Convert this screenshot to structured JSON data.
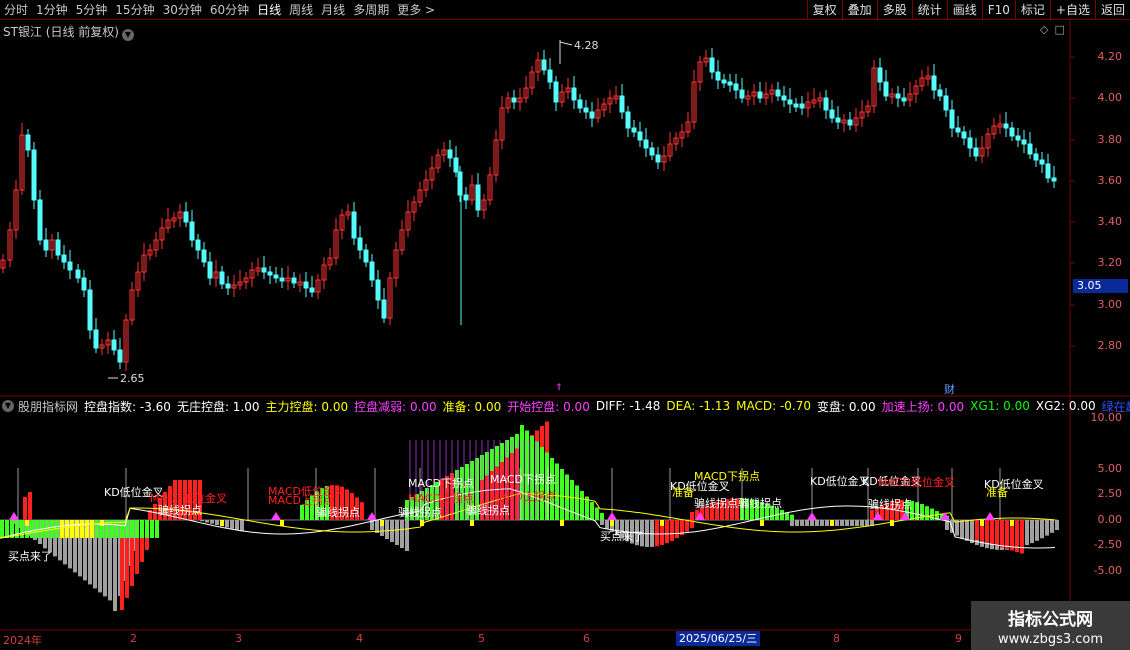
{
  "top_bar": {
    "periods": [
      "分时",
      "1分钟",
      "5分钟",
      "15分钟",
      "30分钟",
      "60分钟",
      "日线",
      "周线",
      "月线",
      "多周期",
      "更多 >"
    ],
    "active_period": "日线",
    "buttons": [
      "复权",
      "叠加",
      "多股",
      "统计",
      "画线",
      "F10",
      "标记",
      "+自选",
      "返回"
    ]
  },
  "stock": {
    "title": "ST银江 (日线 前复权)",
    "y_ticks": [
      "4.20",
      "4.00",
      "3.80",
      "3.60",
      "3.40",
      "3.20",
      "3.00",
      "2.80"
    ],
    "current_price": "3.05",
    "max_label": "4.28",
    "min_label": "2.65",
    "finance_marker": "财",
    "up_color": "#ff3232",
    "down_color": "#54fcfc"
  },
  "indicator": {
    "header": [
      {
        "text": "股朋指标网",
        "color": "#c8c8c8"
      },
      {
        "text": "控盘指数: -3.60",
        "color": "#ffffff"
      },
      {
        "text": "无庄控盘: 1.00",
        "color": "#ffffff"
      },
      {
        "text": "主力控盘: 0.00",
        "color": "#ffff00"
      },
      {
        "text": "控盘减弱: 0.00",
        "color": "#ff40ff"
      },
      {
        "text": "准备: 0.00",
        "color": "#ffff00"
      },
      {
        "text": "开始控盘: 0.00",
        "color": "#ff40ff"
      },
      {
        "text": "DIFF: -1.48",
        "color": "#ffffff"
      },
      {
        "text": "DEA: -1.13",
        "color": "#ffff00"
      },
      {
        "text": "MACD: -0.70",
        "color": "#ffff00"
      },
      {
        "text": "变盘: 0.00",
        "color": "#ffffff"
      },
      {
        "text": "加速上扬: 0.00",
        "color": "#ff40ff"
      },
      {
        "text": "XG1: 0.00",
        "color": "#00ff00"
      },
      {
        "text": "XG2: 0.00",
        "color": "#ffffff"
      },
      {
        "text": "绿在趋了",
        "color": "#3050ff"
      }
    ],
    "y_ticks": [
      "10.00",
      "7.50",
      "5.00",
      "2.50",
      "0.00",
      "-2.50",
      "-5.00"
    ],
    "labels": [
      {
        "text": "买点来了",
        "color": "#ffffff"
      },
      {
        "text": "KD低位金叉",
        "color": "#ffffff"
      },
      {
        "text": "MACD低位金叉",
        "color": "#ff2020"
      },
      {
        "text": "骗线拐点",
        "color": "#ffffff"
      },
      {
        "text": "MACD低位金叉",
        "color": "#ff2020"
      },
      {
        "text": "MACD上拐点",
        "color": "#ff2020"
      },
      {
        "text": "骗线拐点",
        "color": "#ffffff"
      },
      {
        "text": "骗线拐点",
        "color": "#ffffff"
      },
      {
        "text": "MACD下拐点",
        "color": "#ffffff"
      },
      {
        "text": "MACD上拐点",
        "color": "#ff2020"
      },
      {
        "text": "骗线拐点",
        "color": "#ffffff"
      },
      {
        "text": "MACD下拐点",
        "color": "#ffffff"
      },
      {
        "text": "MACD上拐点",
        "color": "#ff2020"
      },
      {
        "text": "买点来了",
        "color": "#ffffff"
      },
      {
        "text": "KD低位金叉",
        "color": "#ffffff"
      },
      {
        "text": "准备",
        "color": "#ffff00"
      },
      {
        "text": "MACD下拐点",
        "color": "#ffff00"
      },
      {
        "text": "骗线拐点骗线拐点",
        "color": "#ffffff"
      },
      {
        "text": "KD低位金叉",
        "color": "#ffffff"
      },
      {
        "text": "KD低位金叉",
        "color": "#ffffff"
      },
      {
        "text": "骗线拐点",
        "color": "#ffffff"
      },
      {
        "text": "MACD低位金叉",
        "color": "#ff2020"
      },
      {
        "text": "KD低位金叉",
        "color": "#ffffff"
      },
      {
        "text": "准备",
        "color": "#ffff00"
      }
    ]
  },
  "x_axis": {
    "dates": [
      "2024年",
      "2",
      "3",
      "4",
      "5",
      "6",
      "7",
      "8",
      "9"
    ],
    "highlight": "2025/06/25/三"
  },
  "watermark": {
    "title": "指标公式网",
    "url": "www.zbgs3.com"
  }
}
